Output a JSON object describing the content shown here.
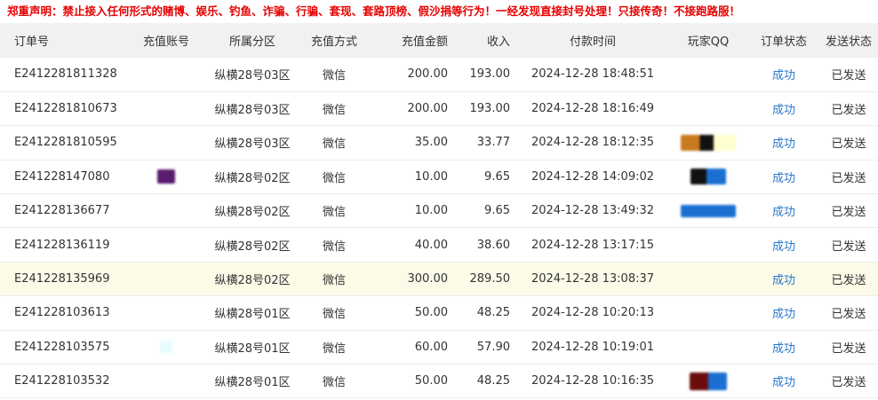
{
  "notice": "郑重声明：禁止接入任何形式的赌博、娱乐、钓鱼、诈骗、行骗、套现、套路顶榜、假沙捐等行为！一经发现直接封号处理！只接传奇！不接跑路服！",
  "columns": [
    "订单号",
    "充值账号",
    "所属分区",
    "充值方式",
    "充值金额",
    "收入",
    "付款时间",
    "玩家QQ",
    "订单状态",
    "发送状态"
  ],
  "rows": [
    {
      "order": "E2412281811328",
      "zone": "纵横28号03区",
      "method": "微信",
      "amount": "200.00",
      "income": "193.00",
      "time": "2024-12-28 18:48:51",
      "status": "成功",
      "send": "已发送"
    },
    {
      "order": "E2412281810673",
      "zone": "纵横28号03区",
      "method": "微信",
      "amount": "200.00",
      "income": "193.00",
      "time": "2024-12-28 18:16:49",
      "status": "成功",
      "send": "已发送"
    },
    {
      "order": "E2412281810595",
      "zone": "纵横28号03区",
      "method": "微信",
      "amount": "35.00",
      "income": "33.77",
      "time": "2024-12-28 18:12:35",
      "status": "成功",
      "send": "已发送"
    },
    {
      "order": "E241228147080",
      "zone": "纵横28号02区",
      "method": "微信",
      "amount": "10.00",
      "income": "9.65",
      "time": "2024-12-28 14:09:02",
      "status": "成功",
      "send": "已发送"
    },
    {
      "order": "E241228136677",
      "zone": "纵横28号02区",
      "method": "微信",
      "amount": "10.00",
      "income": "9.65",
      "time": "2024-12-28 13:49:32",
      "status": "成功",
      "send": "已发送"
    },
    {
      "order": "E241228136119",
      "zone": "纵横28号02区",
      "method": "微信",
      "amount": "40.00",
      "income": "38.60",
      "time": "2024-12-28 13:17:15",
      "status": "成功",
      "send": "已发送"
    },
    {
      "order": "E241228135969",
      "zone": "纵横28号02区",
      "method": "微信",
      "amount": "300.00",
      "income": "289.50",
      "time": "2024-12-28 13:08:37",
      "status": "成功",
      "send": "已发送"
    },
    {
      "order": "E241228103613",
      "zone": "纵横28号01区",
      "method": "微信",
      "amount": "50.00",
      "income": "48.25",
      "time": "2024-12-28 10:20:13",
      "status": "成功",
      "send": "已发送"
    },
    {
      "order": "E241228103575",
      "zone": "纵横28号01区",
      "method": "微信",
      "amount": "60.00",
      "income": "57.90",
      "time": "2024-12-28 10:19:01",
      "status": "成功",
      "send": "已发送"
    },
    {
      "order": "E241228103532",
      "zone": "纵横28号01区",
      "method": "微信",
      "amount": "50.00",
      "income": "48.25",
      "time": "2024-12-28 10:16:35",
      "status": "成功",
      "send": "已发送"
    }
  ],
  "highlight_row": 6,
  "colors": {
    "notice": "#e60000",
    "status_ok": "#2a78c7",
    "header_bg": "#f1f1f1",
    "highlight_bg": "#fbfbe8"
  }
}
